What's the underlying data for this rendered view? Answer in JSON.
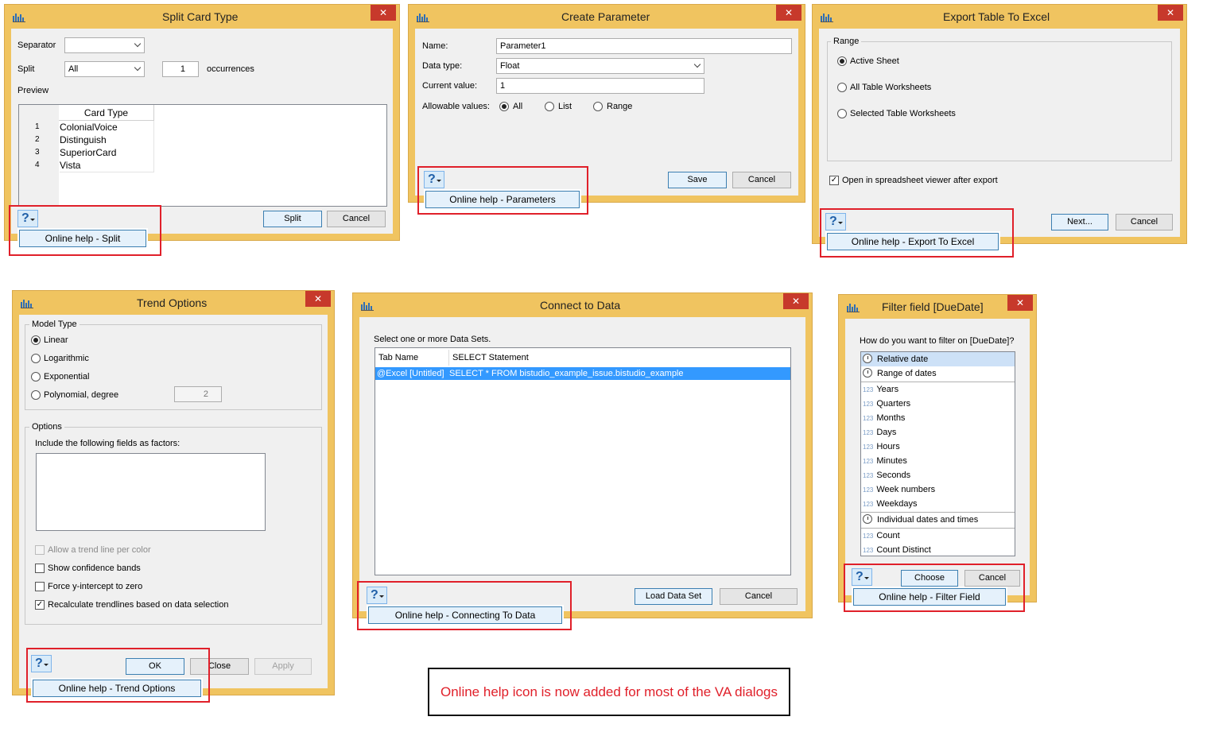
{
  "split": {
    "title": "Split Card Type",
    "close": "✕",
    "separator_label": "Separator",
    "separator_value": "",
    "split_label": "Split",
    "split_value": "All",
    "occ_value": "1",
    "occ_label": "occurrences",
    "preview_label": "Preview",
    "column_header": "Card Type",
    "rows": [
      {
        "num": "1",
        "value": "ColonialVoice"
      },
      {
        "num": "2",
        "value": "Distinguish"
      },
      {
        "num": "3",
        "value": "SuperiorCard"
      },
      {
        "num": "4",
        "value": "Vista"
      }
    ],
    "split_button": "Split",
    "cancel_button": "Cancel",
    "help_icon": "?",
    "help_menu": "Online help - Split"
  },
  "parameter": {
    "title": "Create Parameter",
    "close": "✕",
    "name_label": "Name:",
    "name_value": "Parameter1",
    "type_label": "Data type:",
    "type_value": "Float",
    "current_label": "Current value:",
    "current_value": "1",
    "allowable_label": "Allowable values:",
    "opt_all": "All",
    "opt_list": "List",
    "opt_range": "Range",
    "save_button": "Save",
    "cancel_button": "Cancel",
    "help_icon": "?",
    "help_menu": "Online help - Parameters"
  },
  "export": {
    "title": "Export Table To Excel",
    "close": "✕",
    "range_label": "Range",
    "opt_active": "Active Sheet",
    "opt_all": "All Table Worksheets",
    "opt_selected": "Selected Table Worksheets",
    "check_open": "Open in spreadsheet viewer after export",
    "next_button": "Next...",
    "cancel_button": "Cancel",
    "help_icon": "?",
    "help_menu": "Online help - Export To Excel"
  },
  "trend": {
    "title": "Trend Options",
    "close": "✕",
    "model_label": "Model Type",
    "opt_linear": "Linear",
    "opt_log": "Logarithmic",
    "opt_exp": "Exponential",
    "opt_poly": "Polynomial, degree",
    "degree_value": "2",
    "options_label": "Options",
    "factors_label": "Include the following fields as factors:",
    "chk_trend_color": "Allow a trend line per color",
    "chk_confidence": "Show confidence bands",
    "chk_intercept": "Force y-intercept to zero",
    "chk_recalc": "Recalculate trendlines based on data selection",
    "ok_button": "OK",
    "close_button": "Close",
    "apply_button": "Apply",
    "help_icon": "?",
    "help_menu": "Online help - Trend Options"
  },
  "connect": {
    "title": "Connect to Data",
    "close": "✕",
    "select_label": "Select one or more Data Sets.",
    "col_tab": "Tab Name",
    "col_select": "SELECT Statement",
    "row_tab": "@Excel [Untitled]",
    "row_select": "SELECT * FROM bistudio_example_issue.bistudio_example",
    "load_button": "Load Data Set",
    "cancel_button": "Cancel",
    "help_icon": "?",
    "help_menu": "Online help - Connecting To Data"
  },
  "filter": {
    "title": "Filter field [DueDate]",
    "close": "✕",
    "question": "How do you want to filter on [DueDate]?",
    "group1": [
      "Relative date",
      "Range of dates"
    ],
    "group2": [
      "Years",
      "Quarters",
      "Months",
      "Days",
      "Hours",
      "Minutes",
      "Seconds",
      "Week numbers",
      "Weekdays"
    ],
    "group3": [
      "Individual dates and times"
    ],
    "group4": [
      "Count",
      "Count Distinct"
    ],
    "num_tag": "123",
    "choose_button": "Choose",
    "cancel_button": "Cancel",
    "help_icon": "?",
    "help_menu": "Online help - Filter Field"
  },
  "note": "Online help icon is now added for most of the VA dialogs",
  "colors": {
    "title_bar": "#f0c460",
    "close_red": "#c7392b",
    "highlight_red": "#e0202a",
    "selection_blue": "#3399ff"
  },
  "icons": {
    "app": "chart-app-icon",
    "help": "question-mark-icon",
    "close": "close-icon",
    "clock": "clock-icon"
  }
}
